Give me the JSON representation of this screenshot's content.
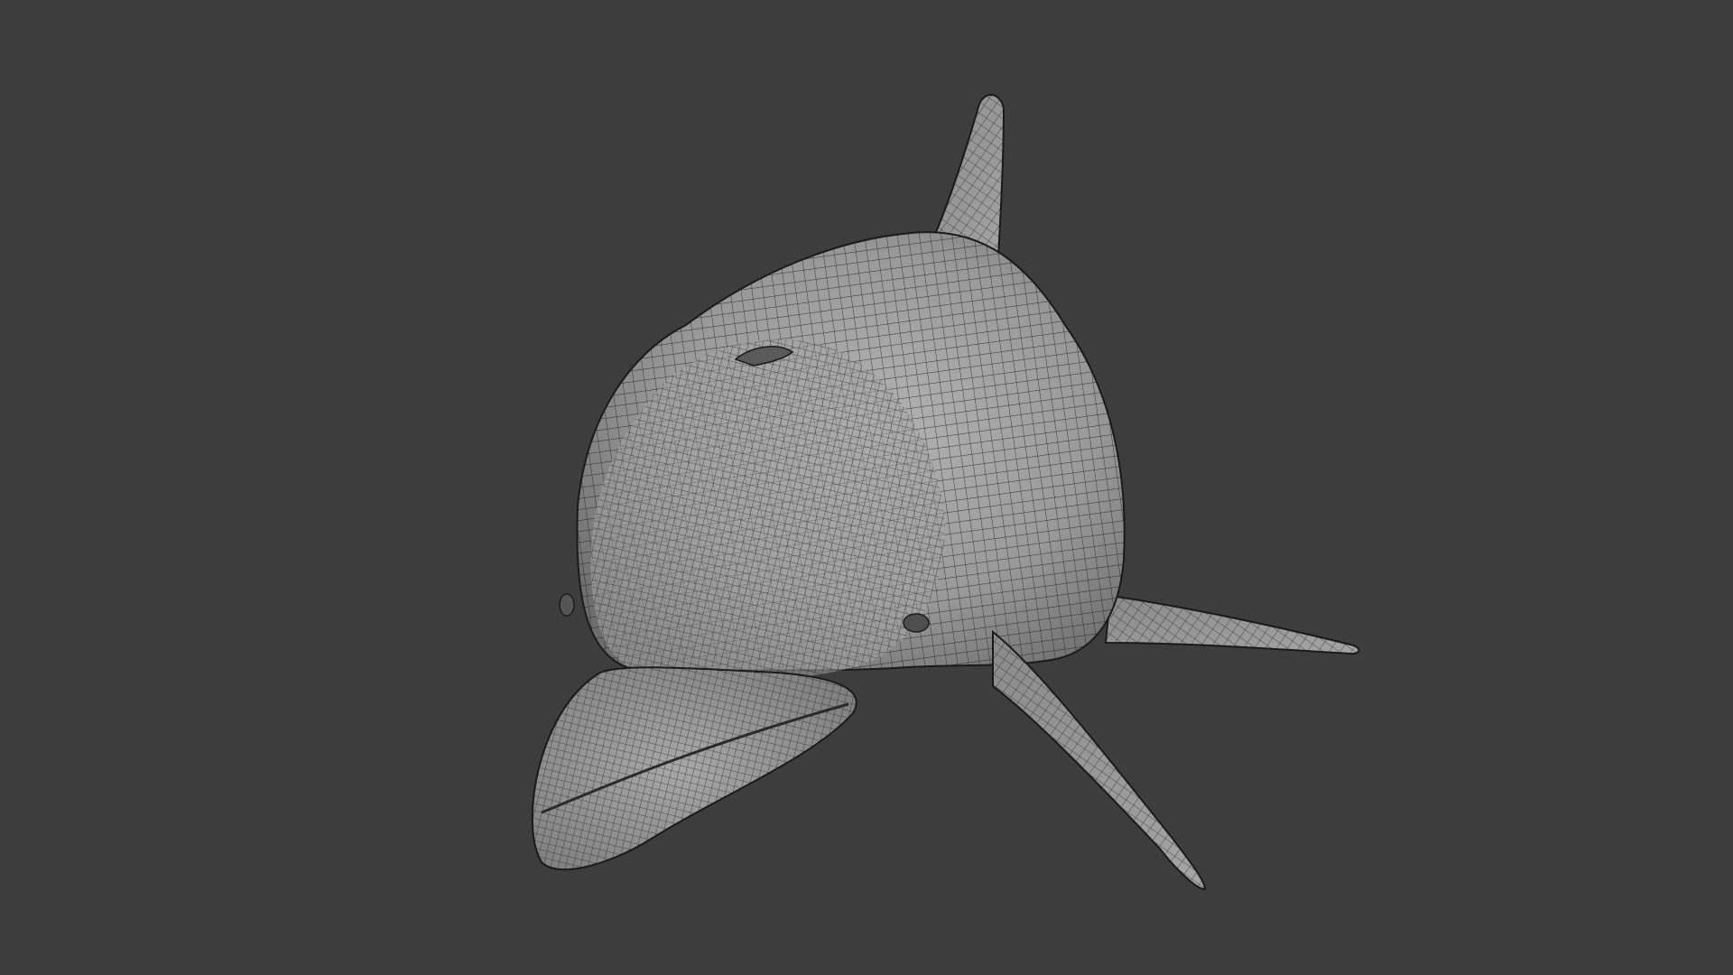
{
  "viewport": {
    "background_color": "#3d3d3d",
    "shading": "solid",
    "overlay": "wireframe"
  },
  "model": {
    "subject": "dolphin",
    "surface_color": "#9b9b9b",
    "wire_color": "#1c1c1c",
    "visible_parts": [
      "head",
      "beak",
      "body",
      "dorsal-fin",
      "left-flipper",
      "right-flipper",
      "blowhole",
      "eyes"
    ]
  }
}
